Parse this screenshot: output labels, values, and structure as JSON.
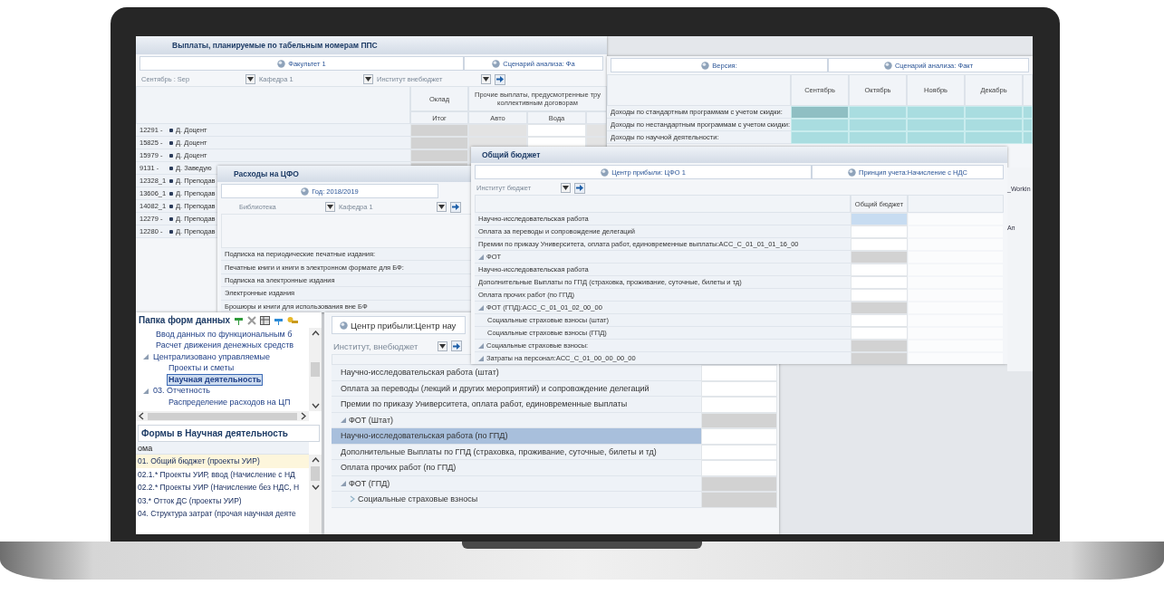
{
  "payments_window": {
    "title": "Выплаты, планируемые по табельным номерам ППС",
    "pov": [
      "Факультет 1",
      "Сценарий анализа: Фа"
    ],
    "filters": [
      "Сентябрь : Sep",
      "Кафедра 1",
      "Институт  внебюджет"
    ],
    "column_groups": [
      "Оклад",
      "Прочие выплаты, предусмотренные тру коллективным договорам"
    ],
    "columns": [
      "Итог",
      "Авто",
      "Вода"
    ],
    "rows": [
      {
        "code": "12291 -",
        "name": "Д. Доцент"
      },
      {
        "code": "15825 -",
        "name": "Д. Доцент"
      },
      {
        "code": "15979 -",
        "name": "Д. Доцент"
      },
      {
        "code": "9131 -",
        "name": "Д. Заведую"
      },
      {
        "code": "12328_1",
        "name": "Д. Преподав"
      },
      {
        "code": "13606_1",
        "name": "Д. Преподав"
      },
      {
        "code": "14082_1",
        "name": "Д. Преподав"
      },
      {
        "code": "12279 -",
        "name": "Д. Преподав"
      },
      {
        "code": "12280 -",
        "name": "Д. Преподав"
      }
    ]
  },
  "revenue_window": {
    "pov": [
      "Версия:",
      "Сценарий анализа: Факт"
    ],
    "columns": [
      "Сентябрь",
      "Октябрь",
      "Ноябрь",
      "Декабрь"
    ],
    "rows": [
      {
        "label": "Доходы по стандартным программам с учетом скидки:",
        "selected": true
      },
      {
        "label": "Доходы по нестандартным программам с учетом скидки:",
        "selected": false
      },
      {
        "label": "Доходы по научной деятельности:",
        "selected": false
      }
    ]
  },
  "cfo_window": {
    "title": "Расходы на ЦФО",
    "pov": [
      "Год: 2018/2019"
    ],
    "filters": [
      "Библиотека",
      "Кафедра 1"
    ],
    "rows": [
      "Подписка на периодические печатные издания:",
      "Печатные книги и книги в электронном формате для БФ:",
      "Подписка на электронные издания",
      "Электронные издания",
      "Брошюры и книги для использования вне БФ"
    ]
  },
  "budget_window": {
    "title": "Общий бюджет",
    "pov": [
      "Центр прибыли: ЦФО 1",
      "Принцип учета:Начисление с НДС"
    ],
    "filters": [
      "Институт бюджет"
    ],
    "column": "Общий бюджет",
    "rows": [
      {
        "label": "Научно-исследовательская работа",
        "kind": "member",
        "selected": true
      },
      {
        "label": "Оплата за переводы  и сопровождение делегаций",
        "kind": "member",
        "selected": false
      },
      {
        "label": "Премии по приказу Университета, оплата работ, единовременные выплаты:ACC_C_01_01_01_16_00",
        "kind": "member",
        "selected": false
      },
      {
        "label": "ФОТ",
        "kind": "total",
        "expanded": true,
        "selected": false
      },
      {
        "label": "Научно-исследовательская работа",
        "kind": "member",
        "selected": false
      },
      {
        "label": "Дополнительные Выплаты по ГПД (страховка, проживание, суточные, билеты и тд)",
        "kind": "member",
        "selected": false
      },
      {
        "label": "Оплата прочих работ (по ГПД)",
        "kind": "member",
        "selected": false
      },
      {
        "label": "ФОТ (ГПД):ACC_C_01_01_02_00_00",
        "kind": "total",
        "expanded": true,
        "selected": false
      },
      {
        "label": "Социальные страховые взносы:",
        "kind": "total",
        "expanded": true,
        "selected": false,
        "children": [
          {
            "label": "Социальные страховые взносы (штат)",
            "kind": "member",
            "selected": false
          },
          {
            "label": "Социальные страховые взносы (ГПД)",
            "kind": "member",
            "selected": false
          }
        ]
      },
      {
        "label": "Затраты на персонал:ACC_C_01_00_00_00_00",
        "kind": "total",
        "expanded": true,
        "selected": false
      }
    ]
  },
  "background_labels": [
    "_Workin",
    "Ап"
  ],
  "forms_folder": {
    "title": "Папка форм данных",
    "tree": [
      {
        "label": "Ввод данных по функциональным б",
        "selected": false
      },
      {
        "label": "Расчет движения денежных средств",
        "selected": false
      },
      {
        "label": "Централизовано управляемые",
        "expanded": true,
        "selected": false,
        "children": [
          {
            "label": "Проекты и сметы",
            "selected": false
          },
          {
            "label": "Научная деятельность",
            "selected": true
          }
        ]
      },
      {
        "label": "03. Отчетность",
        "expanded": true,
        "selected": false,
        "children": [
          {
            "label": "Распределение расходов на ЦП",
            "selected": false
          }
        ]
      }
    ],
    "forms_title": "Формы в Научная деятельность",
    "forms_column": "ома",
    "forms": [
      {
        "label": "01. Общий бюджет (проекты УИР)",
        "selected": true
      },
      {
        "label": "02.1.* Проекты УИР, ввод (Начисление с НД",
        "selected": false
      },
      {
        "label": "02.2.* Проекты УИР (Начисление без НДС, Н",
        "selected": false
      },
      {
        "label": "03.* Отток ДС (проекты УИР)",
        "selected": false
      },
      {
        "label": "04. Структура затрат (прочая научная деяте",
        "selected": false
      }
    ]
  },
  "main_window": {
    "pov": [
      "Центр прибыли:Центр нау"
    ],
    "filters": [
      "Институт, внебюджет"
    ],
    "rows": [
      {
        "label": "Научно-исследовательская работа (штат)",
        "kind": "member",
        "selected": false
      },
      {
        "label": "Оплата за переводы (лекций и других мероприятий) и сопровождение делегаций",
        "kind": "member",
        "selected": false
      },
      {
        "label": "Премии по приказу Университета, оплата работ, единовременные выплаты",
        "kind": "member",
        "selected": false
      },
      {
        "label": "ФОТ (Штат)",
        "kind": "total",
        "expanded": true,
        "selected": false
      },
      {
        "label": "Научно-исследовательская работа (по ГПД)",
        "kind": "member",
        "selected": true
      },
      {
        "label": "Дополнительные Выплаты по ГПД (страховка, проживание, суточные, билеты и тд)",
        "kind": "member",
        "selected": false
      },
      {
        "label": "Оплата прочих работ (по ГПД)",
        "kind": "member",
        "selected": false
      },
      {
        "label": "ФОТ (ГПД)",
        "kind": "total",
        "expanded": true,
        "selected": false
      },
      {
        "label": "Социальные страховые взносы",
        "kind": "total",
        "expanded": false,
        "selected": false
      }
    ]
  }
}
